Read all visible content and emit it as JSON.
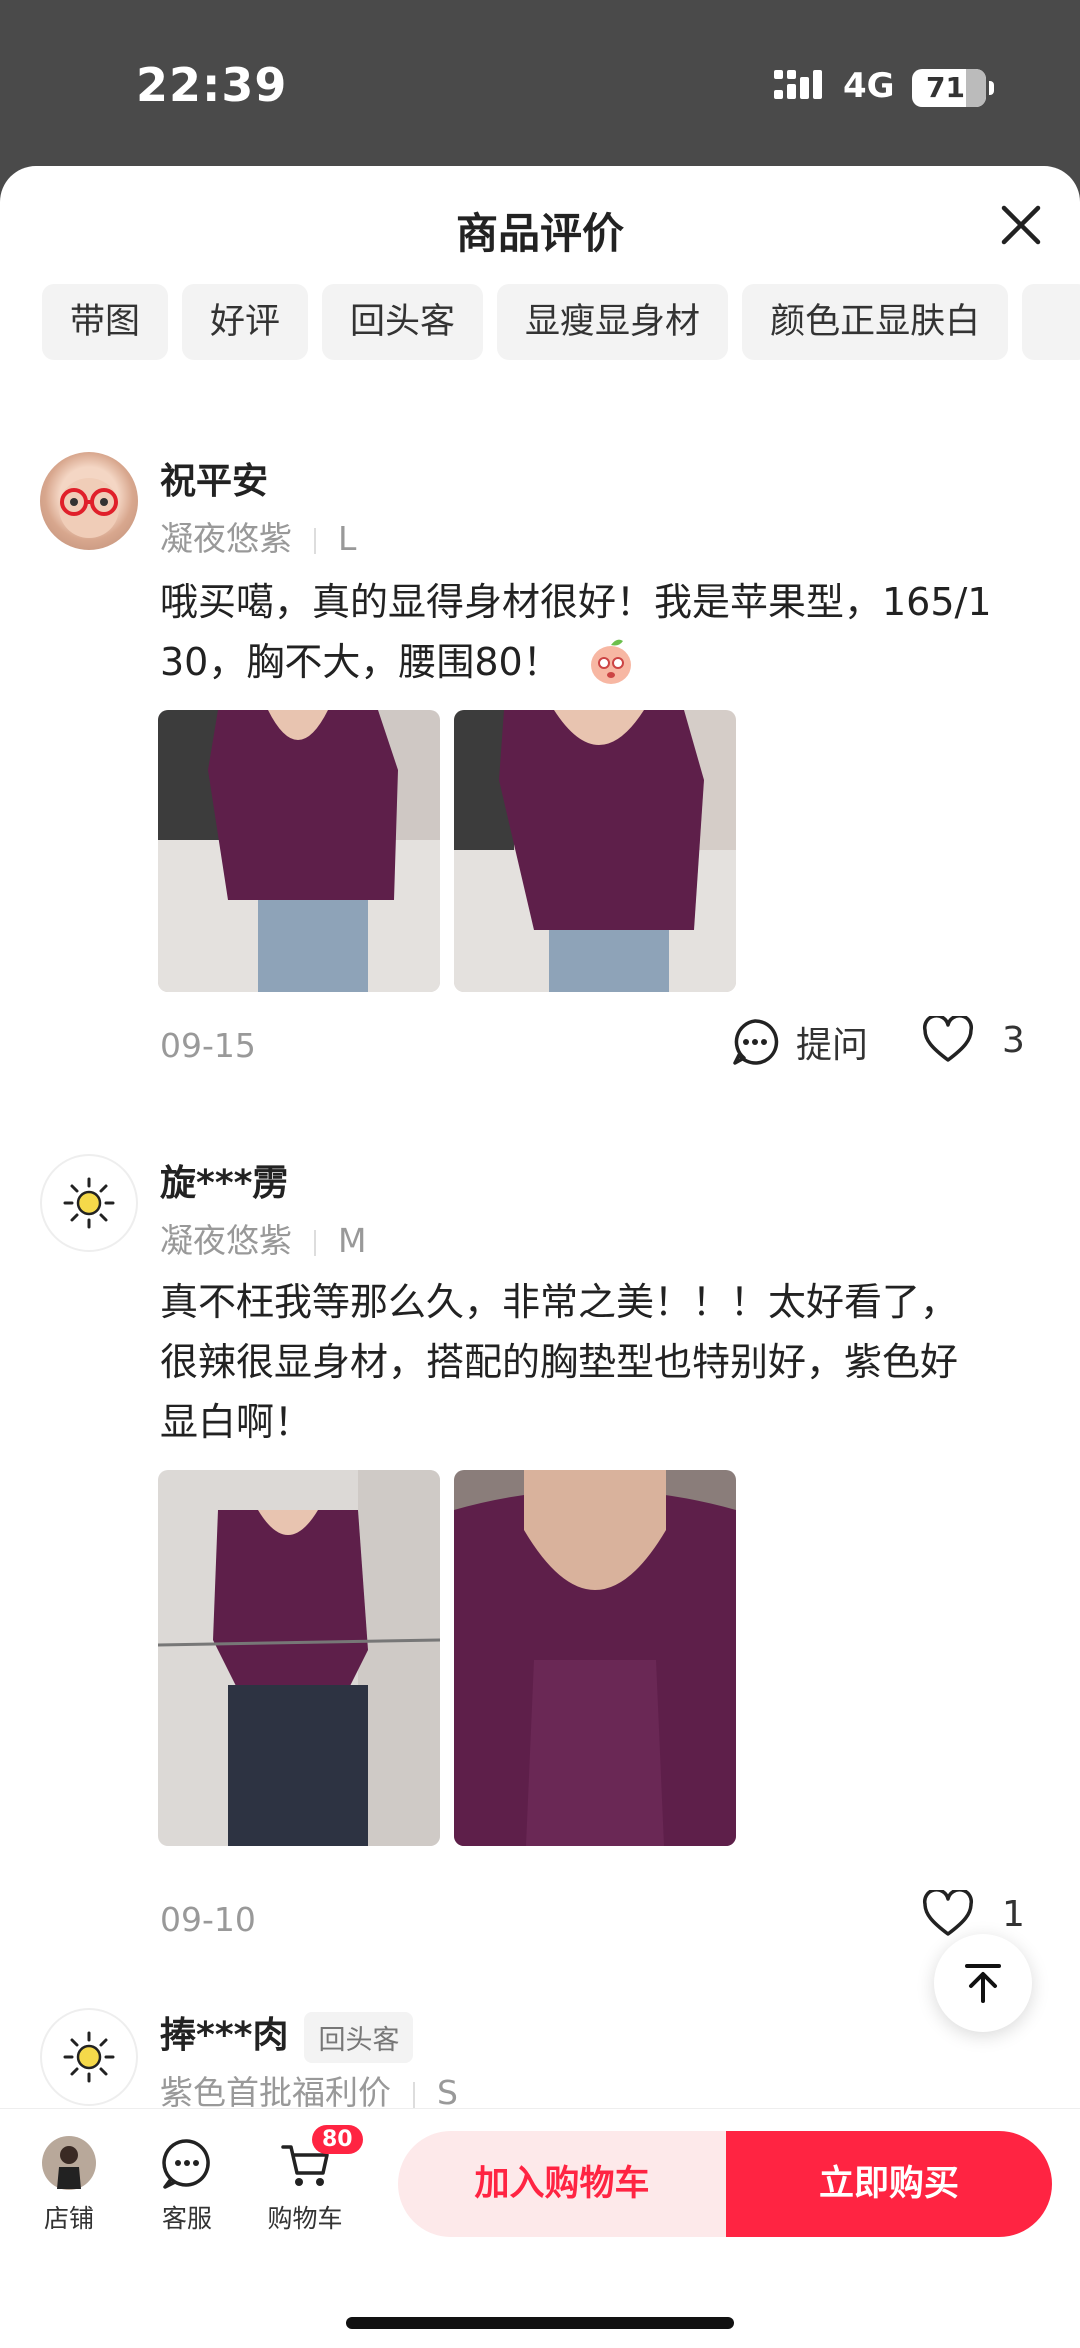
{
  "status_bar": {
    "time": "22:39",
    "network": "4G",
    "battery": "71"
  },
  "sheet": {
    "title": "商品评价"
  },
  "tags": [
    "带图",
    "好评",
    "回头客",
    "显瘦显身材",
    "颜色正显肤白"
  ],
  "reviews": [
    {
      "username": "祝平安",
      "color": "凝夜悠紫",
      "size": "L",
      "text": "哦买噶，真的显得身材很好！我是苹果型，165/1",
      "text2": "30，胸不大，腰围80！",
      "date": "09-15",
      "ask_label": "提问",
      "likes": "3"
    },
    {
      "username": "旋***雳",
      "color": "凝夜悠紫",
      "size": "M",
      "text": "真不枉我等那么久，非常之美！！！太好看了，",
      "text2": "很辣很显身材，搭配的胸垫型也特别好，紫色好",
      "text3": "显白啊！",
      "date": "09-10",
      "likes": "1"
    },
    {
      "username": "捧***肉",
      "badge": "回头客",
      "color": "紫色首批福利价",
      "size": "S"
    }
  ],
  "bottom_nav": {
    "shop": "店铺",
    "service": "客服",
    "cart": "购物车",
    "cart_count": "80",
    "add_to_cart": "加入购物车",
    "buy_now": "立即购买"
  },
  "colors": {
    "accent": "#ff2442",
    "accent_light": "#fde9ea",
    "product_purple": "#5e1f4a"
  }
}
